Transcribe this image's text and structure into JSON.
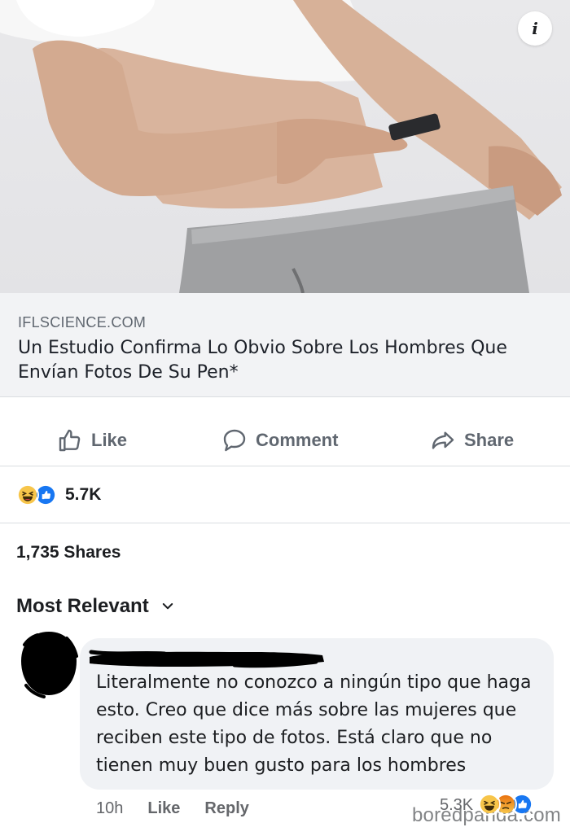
{
  "post": {
    "info_icon": "info-icon",
    "link": {
      "domain": "IFLSCIENCE.COM",
      "title": "Un Estudio Confirma Lo Obvio Sobre Los Hombres Que Envían Fotos De Su Pen*"
    },
    "actions": {
      "like": "Like",
      "comment": "Comment",
      "share": "Share"
    },
    "reactions": {
      "icons": [
        "haha-reaction-icon",
        "like-reaction-icon"
      ],
      "count": "5.7K"
    },
    "shares": "1,735 Shares",
    "sort_label": "Most Relevant"
  },
  "comment": {
    "text": "Literalmente no conozco a ningún tipo que haga esto. Creo que dice más sobre las mujeres que reciben este tipo de fotos. Está claro que no tienen muy buen gusto para los hombres",
    "time": "10h",
    "like": "Like",
    "reply": "Reply",
    "reaction_count": "5.3K",
    "reaction_icons": [
      "haha-reaction-icon",
      "angry-reaction-icon",
      "like-reaction-icon"
    ]
  },
  "watermark": "boredpanda.com",
  "colors": {
    "facebook_blue": "#1877f2",
    "haha_yellow": "#f7c54a",
    "angry_orange": "#e9710f",
    "secondary_text": "#606770",
    "bubble_bg": "#f0f2f5"
  }
}
